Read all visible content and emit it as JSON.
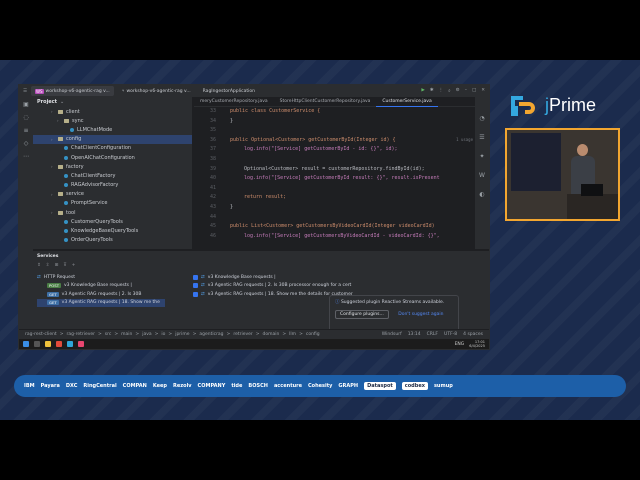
{
  "ide": {
    "titlebar": {
      "tabs": [
        {
          "badge": "WS",
          "label": "workshop-v6-agentic-rag v..."
        },
        {
          "badge": "",
          "label": "workshop-v6-agentic-rag v..."
        },
        {
          "badge": "",
          "label": "RagIngestorApplication"
        }
      ]
    },
    "project": {
      "title": "Project",
      "tree": [
        {
          "label": "client",
          "kind": "folder",
          "indent": 3
        },
        {
          "label": "sync",
          "kind": "folder",
          "indent": 4
        },
        {
          "label": "LLMChatMode",
          "kind": "class",
          "indent": 5
        },
        {
          "label": "config",
          "kind": "folder",
          "indent": 3,
          "selected": true
        },
        {
          "label": "ChatClientConfiguration",
          "kind": "class",
          "indent": 4
        },
        {
          "label": "OpenAIChatConfiguration",
          "kind": "class",
          "indent": 4
        },
        {
          "label": "factory",
          "kind": "folder",
          "indent": 3
        },
        {
          "label": "ChatClientFactory",
          "kind": "class",
          "indent": 4
        },
        {
          "label": "RAGAdvisorFactory",
          "kind": "class",
          "indent": 4
        },
        {
          "label": "service",
          "kind": "folder",
          "indent": 3
        },
        {
          "label": "PromptService",
          "kind": "class",
          "indent": 4
        },
        {
          "label": "tool",
          "kind": "folder",
          "indent": 3
        },
        {
          "label": "CustomerQueryTools",
          "kind": "class",
          "indent": 4
        },
        {
          "label": "KnowledgeBaseQueryTools",
          "kind": "class",
          "indent": 4
        },
        {
          "label": "OrderQueryTools",
          "kind": "class",
          "indent": 4
        }
      ]
    },
    "editor": {
      "tabs": [
        {
          "label": "meryCustomerRepository.java",
          "active": false
        },
        {
          "label": "StoreHttpClientCustomerRepository.java",
          "active": false
        },
        {
          "label": "CustomerService.java",
          "active": true
        }
      ],
      "usage_hint": "1 usage",
      "lines": [
        {
          "n": "33",
          "text": "public class CustomerService {"
        },
        {
          "n": "34",
          "text": "}"
        },
        {
          "n": "35",
          "text": ""
        },
        {
          "n": "36",
          "text": "public Optional<Customer> getCustomerById(Integer id) {"
        },
        {
          "n": "37",
          "text": "log.info(\"[Service] getCustomerById - id: {}\", id);"
        },
        {
          "n": "38",
          "text": ""
        },
        {
          "n": "39",
          "text": "Optional<Customer> result = customerRepository.findById(id);"
        },
        {
          "n": "40",
          "text": "log.info(\"[Service] getCustomerById result: {}\", result.isPresent"
        },
        {
          "n": "41",
          "text": ""
        },
        {
          "n": "42",
          "text": "return result;"
        },
        {
          "n": "43",
          "text": "}"
        },
        {
          "n": "44",
          "text": ""
        },
        {
          "n": "45",
          "text": "public List<Customer> getCustomersByVideoCardId(Integer videoCardId)"
        },
        {
          "n": "46",
          "text": "log.info(\"[Service] getCustomersByVideoCardId - videoCardId: {}\","
        }
      ]
    },
    "services": {
      "title": "Services",
      "left_rows": [
        {
          "method": "",
          "label": "HTTP Request",
          "selected": false
        },
        {
          "method": "POST",
          "label": "v3 Knowledge Base requests |",
          "selected": false
        },
        {
          "method": "GET",
          "label": "v3 Agentic RAG requests | 2. Is 30B",
          "selected": false
        },
        {
          "method": "GET",
          "label": "v3 Agentic RAG requests | 18. Show me the",
          "selected": true
        }
      ],
      "right_rows": [
        "v3 Knowledge Base requests |",
        "v3 Agentic RAG requests | 2. Is 30B processor enough for a cert",
        "v3 Agentic RAG requests | 18. Show me the details for customer"
      ]
    },
    "popup": {
      "message": "Suggested plugin Reactive Streams available.",
      "configure": "Configure plugins...",
      "dismiss": "Don't suggest again"
    },
    "statusbar": {
      "breadcrumb": [
        "rag-rest-client",
        ">",
        "rag-retriever",
        ">",
        "src",
        ">",
        "main",
        ">",
        "java",
        ">",
        "io",
        ">",
        "jprime",
        ">",
        "agenticrag",
        ">",
        "retriever",
        ">",
        "domain",
        ">",
        "llm",
        ">",
        "config"
      ],
      "right": [
        "Windsurf",
        "13:14",
        "CRLF",
        "UTF-8",
        "4 spaces"
      ]
    },
    "taskbar": {
      "lang": "ENG",
      "time": "17:01",
      "date": "6/4/2025"
    }
  },
  "brand": {
    "name_j": "j",
    "name_rest": "Prime"
  },
  "sponsors": [
    "IBM",
    "Payara",
    "DXC",
    "RingCentral",
    "COMPAN",
    "Keep",
    "Rezolv",
    "COMPANY",
    "tide",
    "BOSCH",
    "accenture",
    "Cohesity",
    "GRAPH",
    "Dataspot",
    "codbex",
    "sumup"
  ]
}
